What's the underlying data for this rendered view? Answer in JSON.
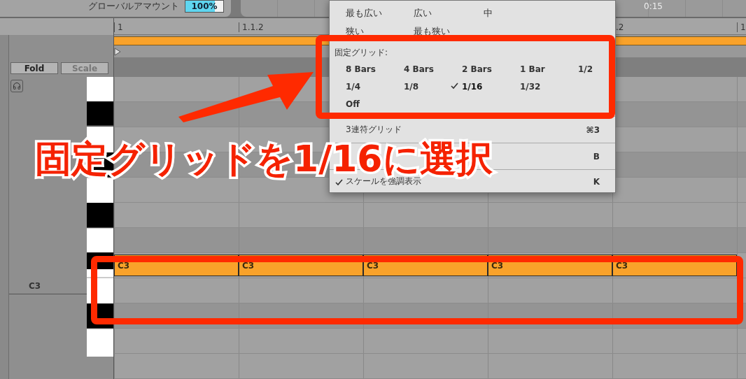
{
  "device": {
    "label": "グローバルアマウント",
    "value": "100%"
  },
  "timeline": {
    "time": "0:15"
  },
  "ruler": {
    "marks": [
      {
        "label": "1"
      },
      {
        "label": "1.1.2"
      },
      {
        "label": ".2"
      },
      {
        "label": "1"
      }
    ]
  },
  "editor": {
    "fold_button": {
      "label": "Fold",
      "disabled": false
    },
    "scale_button": {
      "label": "Scale",
      "disabled": true
    },
    "key_label": "C3"
  },
  "notes": [
    {
      "label": "C3"
    },
    {
      "label": "C3"
    },
    {
      "label": "C3"
    },
    {
      "label": "C3"
    },
    {
      "label": "C3"
    }
  ],
  "menu": {
    "adaptive_options": [
      {
        "label": "最も広い"
      },
      {
        "label": "広い"
      },
      {
        "label": "中"
      },
      {
        "label": "狭い"
      },
      {
        "label": "最も狭い"
      }
    ],
    "fixed_grid": {
      "title": "固定グリッド:",
      "rows": [
        [
          {
            "label": "8 Bars",
            "selected": false
          },
          {
            "label": "4 Bars",
            "selected": false
          },
          {
            "label": "2 Bars",
            "selected": false
          },
          {
            "label": "1 Bar",
            "selected": false
          },
          {
            "label": "1/2",
            "selected": false
          }
        ],
        [
          {
            "label": "1/4",
            "selected": false
          },
          {
            "label": "1/8",
            "selected": false
          },
          {
            "label": "1/16",
            "selected": true
          },
          {
            "label": "1/32",
            "selected": false
          }
        ],
        [
          {
            "label": "Off",
            "selected": false
          }
        ]
      ]
    },
    "items": [
      {
        "label": "3連符グリッド",
        "shortcut": "⌘3",
        "checked": false
      },
      {
        "shortcut": "B"
      },
      {
        "label": "スケールを強調表示",
        "shortcut": "K",
        "checked": true
      }
    ]
  },
  "annotation": {
    "caption": "固定グリッドを1/16に選択"
  }
}
